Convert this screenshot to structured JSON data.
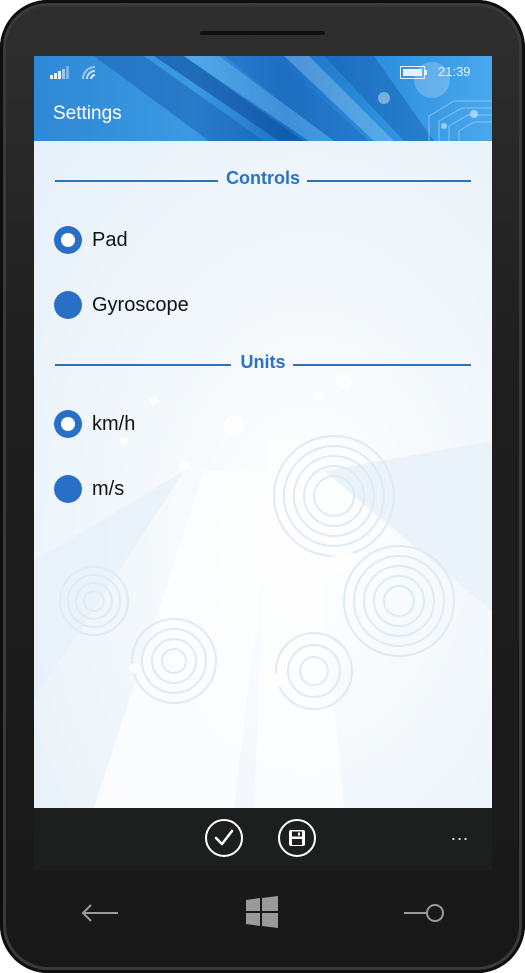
{
  "status_bar": {
    "time": "21:39",
    "icons": [
      "signal-icon",
      "wifi-icon",
      "battery-icon"
    ]
  },
  "header": {
    "title": "Settings"
  },
  "sections": {
    "controls": {
      "title": "Controls",
      "options": [
        {
          "label": "Pad",
          "selected": true
        },
        {
          "label": "Gyroscope",
          "selected": false
        }
      ]
    },
    "units": {
      "title": "Units",
      "options": [
        {
          "label": "km/h",
          "selected": true
        },
        {
          "label": "m/s",
          "selected": false
        }
      ]
    }
  },
  "app_bar": {
    "buttons": [
      "check-icon",
      "save-icon"
    ],
    "more_label": "..."
  },
  "hardware_keys": [
    "back-icon",
    "windows-icon",
    "search-icon"
  ],
  "colors": {
    "accent": "#2a73c4",
    "radio": "#2a6fc6",
    "app_bar": "#1c1f1e",
    "header": "#2f88d6"
  }
}
